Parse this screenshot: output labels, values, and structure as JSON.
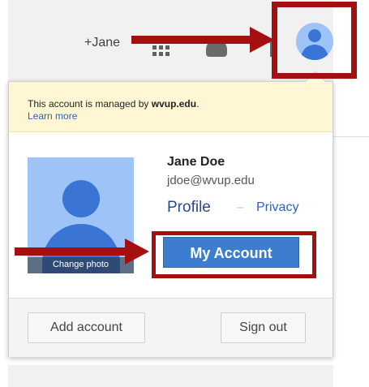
{
  "header": {
    "user_link": "+Jane"
  },
  "account_panel": {
    "managed_notice_prefix": "This account is managed by ",
    "managed_domain": "wvup.edu",
    "managed_suffix": ".",
    "learn_more": "Learn more",
    "photo_overlay": "Change photo",
    "name": "Jane Doe",
    "email": "jdoe@wvup.edu",
    "profile_link": "Profile",
    "separator": "–",
    "privacy_link": "Privacy",
    "my_account_button": "My Account",
    "add_account_button": "Add account",
    "sign_out_button": "Sign out"
  },
  "icons": {
    "apps": "apps-grid-icon",
    "notifications": "notifications-icon",
    "share": "share-icon",
    "avatar": "avatar-icon"
  },
  "colors": {
    "annotation_red": "#a3100f",
    "primary_blue": "#3d7dcf",
    "avatar_bg": "#9ec3f6",
    "notice_bg": "#fff7d3"
  }
}
